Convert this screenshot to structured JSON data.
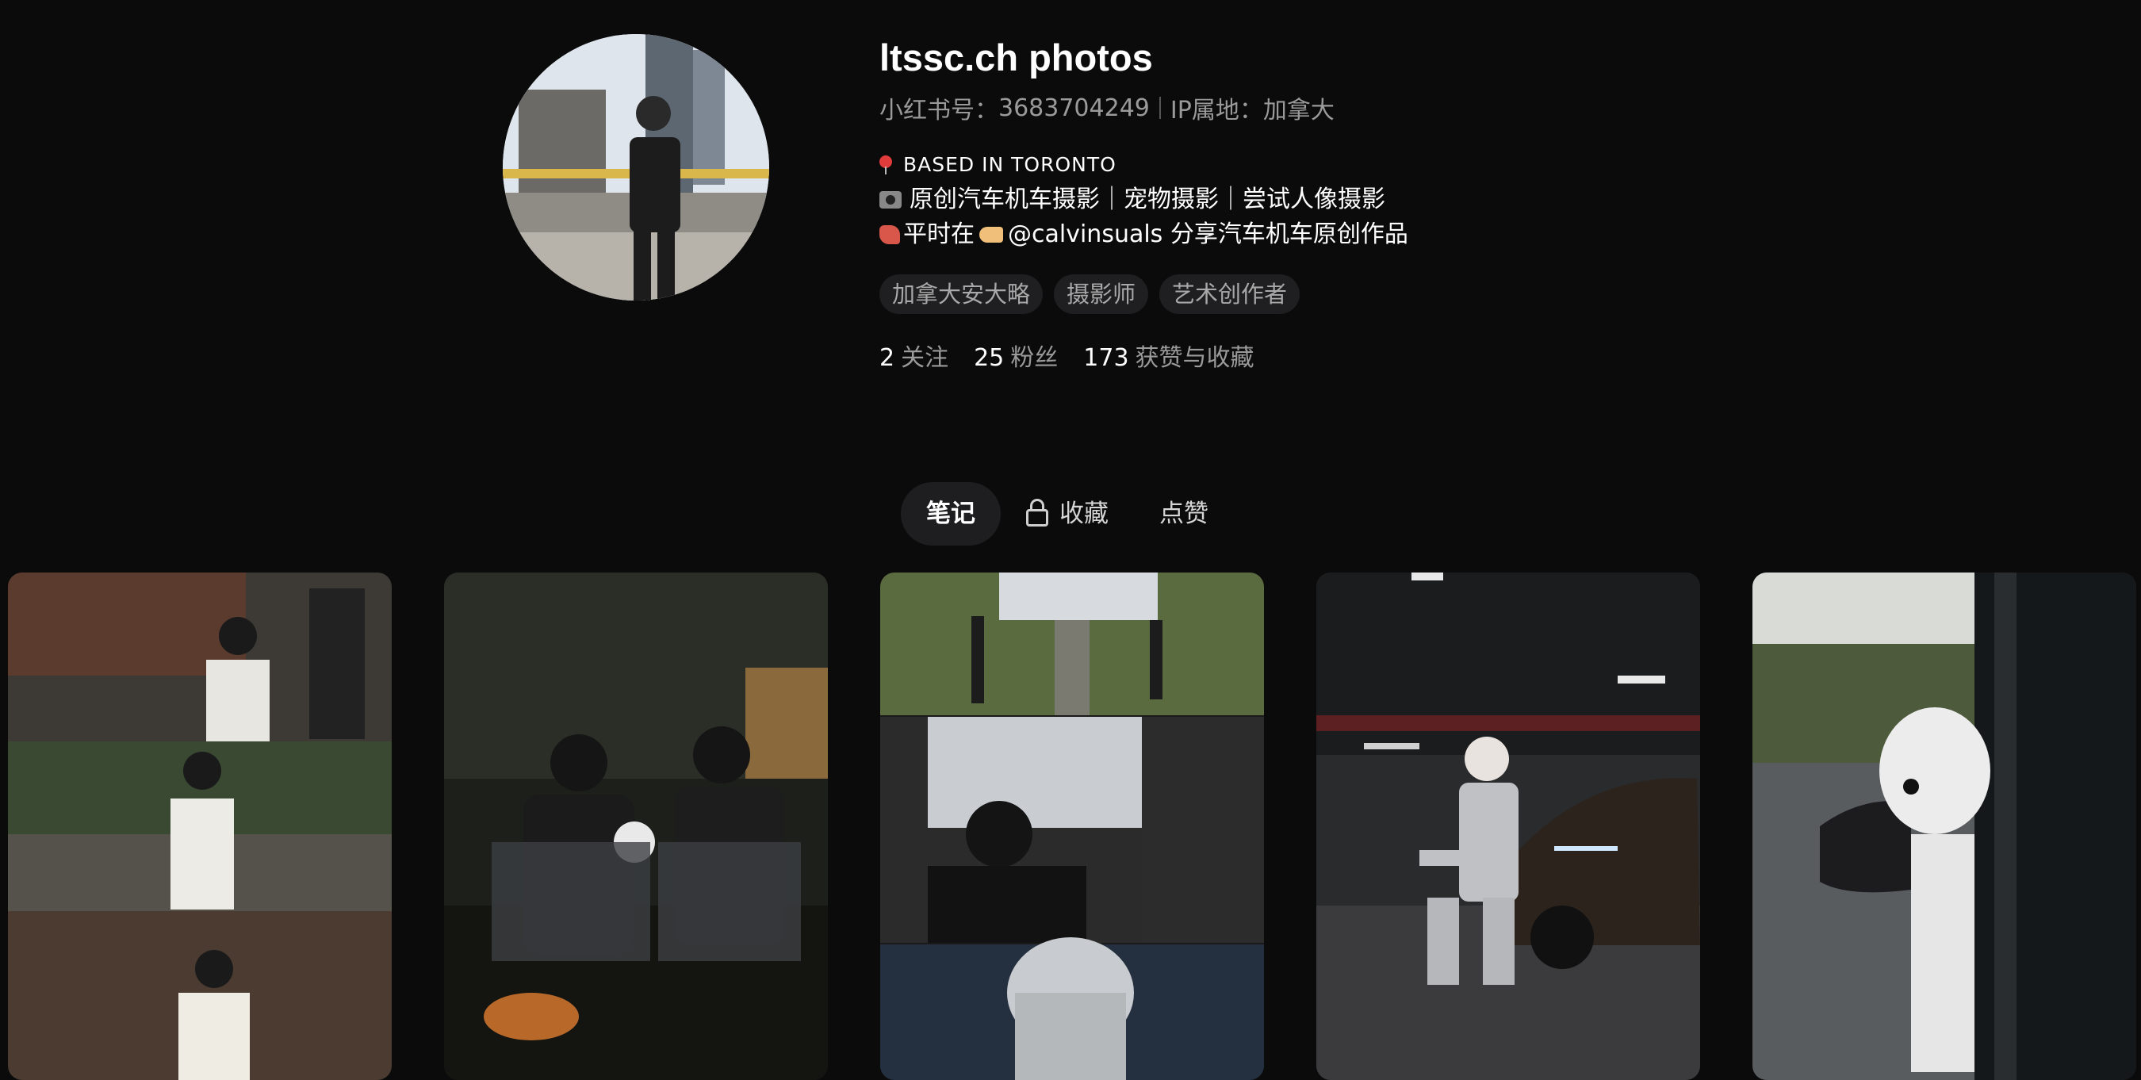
{
  "profile": {
    "name": "ltssc.ch photos",
    "red_id_label": "小红书号：",
    "red_id": "3683704249",
    "ip_label": "IP属地：",
    "ip_location": "加拿大",
    "bio_line1": "BASED IN TORONTO",
    "bio_line2": "原创汽车机车摄影｜宠物摄影｜尝试人像摄影",
    "bio_line3_a": "平时在",
    "bio_line3_b": "@calvinsuals 分享汽车机车原创作品",
    "tags": [
      "加拿大安大略",
      "摄影师",
      "艺术创作者"
    ],
    "stats": [
      {
        "value": "2",
        "label": "关注"
      },
      {
        "value": "25",
        "label": "粉丝"
      },
      {
        "value": "173",
        "label": "获赞与收藏"
      }
    ]
  },
  "tabs": [
    {
      "label": "笔记",
      "active": true
    },
    {
      "label": "收藏",
      "icon": "lock-icon"
    },
    {
      "label": "点赞"
    }
  ],
  "notes": [
    {
      "subject": "portrait-collage-street"
    },
    {
      "subject": "campfire-couple-with-dog"
    },
    {
      "subject": "observatory-portrait-collage"
    },
    {
      "subject": "clown-with-sports-car-parking-garage"
    },
    {
      "subject": "white-dog-car-window"
    }
  ],
  "colors": {
    "background": "#0b0b0c",
    "tag_bg": "#1f1f21",
    "muted_text": "#9a9a9a",
    "active_tab_bg": "#1e1e20"
  }
}
